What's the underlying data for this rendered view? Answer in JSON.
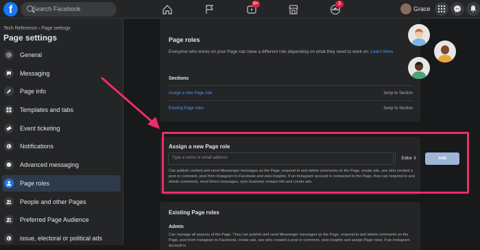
{
  "topbar": {
    "logo": "f",
    "search_placeholder": "Search Facebook",
    "video_badge": "9+",
    "groups_badge": "3",
    "username": "Grace"
  },
  "sidebar": {
    "breadcrumb": "Tech Reference › Page settings",
    "title": "Page settings",
    "items": [
      {
        "label": "General",
        "icon": "gear-icon"
      },
      {
        "label": "Messaging",
        "icon": "chat-bubble-icon"
      },
      {
        "label": "Page info",
        "icon": "pencil-icon"
      },
      {
        "label": "Templates and tabs",
        "icon": "grid-icon"
      },
      {
        "label": "Event ticketing",
        "icon": "ticket-icon"
      },
      {
        "label": "Notifications",
        "icon": "globe-icon"
      },
      {
        "label": "Advanced messaging",
        "icon": "messenger-icon"
      },
      {
        "label": "Page roles",
        "icon": "person-icon",
        "active": true
      },
      {
        "label": "People and other Pages",
        "icon": "people-icon"
      },
      {
        "label": "Preferred Page Audience",
        "icon": "people-icon"
      },
      {
        "label": "issue, electoral or political ads",
        "icon": "globe-icon"
      }
    ]
  },
  "main": {
    "roles_title": "Page roles",
    "roles_desc": "Everyone who works on your Page can have a different role depending on what they need to work on.",
    "learn_more": "Learn More",
    "sections_title": "Sections",
    "sections": [
      {
        "label": "Assign a new Page role",
        "jump": "Jump to Section"
      },
      {
        "label": "Existing Page roles",
        "jump": "Jump to Section"
      }
    ],
    "assign_title": "Assign a new Page role",
    "assign_placeholder": "Type a name or email address",
    "role_select": "Editor ⇕",
    "add_label": "Add",
    "assign_desc": "Can publish content and send Messenger messages as the Page, respond to and delete comments on the Page, create ads, see who created a post or comment, post from Instagram to Facebook and view insights. If an Instagram account is connected to the Page, they can respond to and delete comments, send Direct messages, sync business contact info and create ads.",
    "existing_title": "Existing Page roles",
    "admin_title": "Admin",
    "admin_desc": "Can manage all aspects of the Page. They can publish and send Messenger messages as the Page, respond to and delete comments on the Page, post from Instagram to Facebook, create ads, see who created a post or comment, view insights and assign Page roles. If an Instagram account is"
  },
  "colors": {
    "accent": "#1877f2",
    "highlight": "#ee2c6d",
    "link": "#4599ff"
  }
}
